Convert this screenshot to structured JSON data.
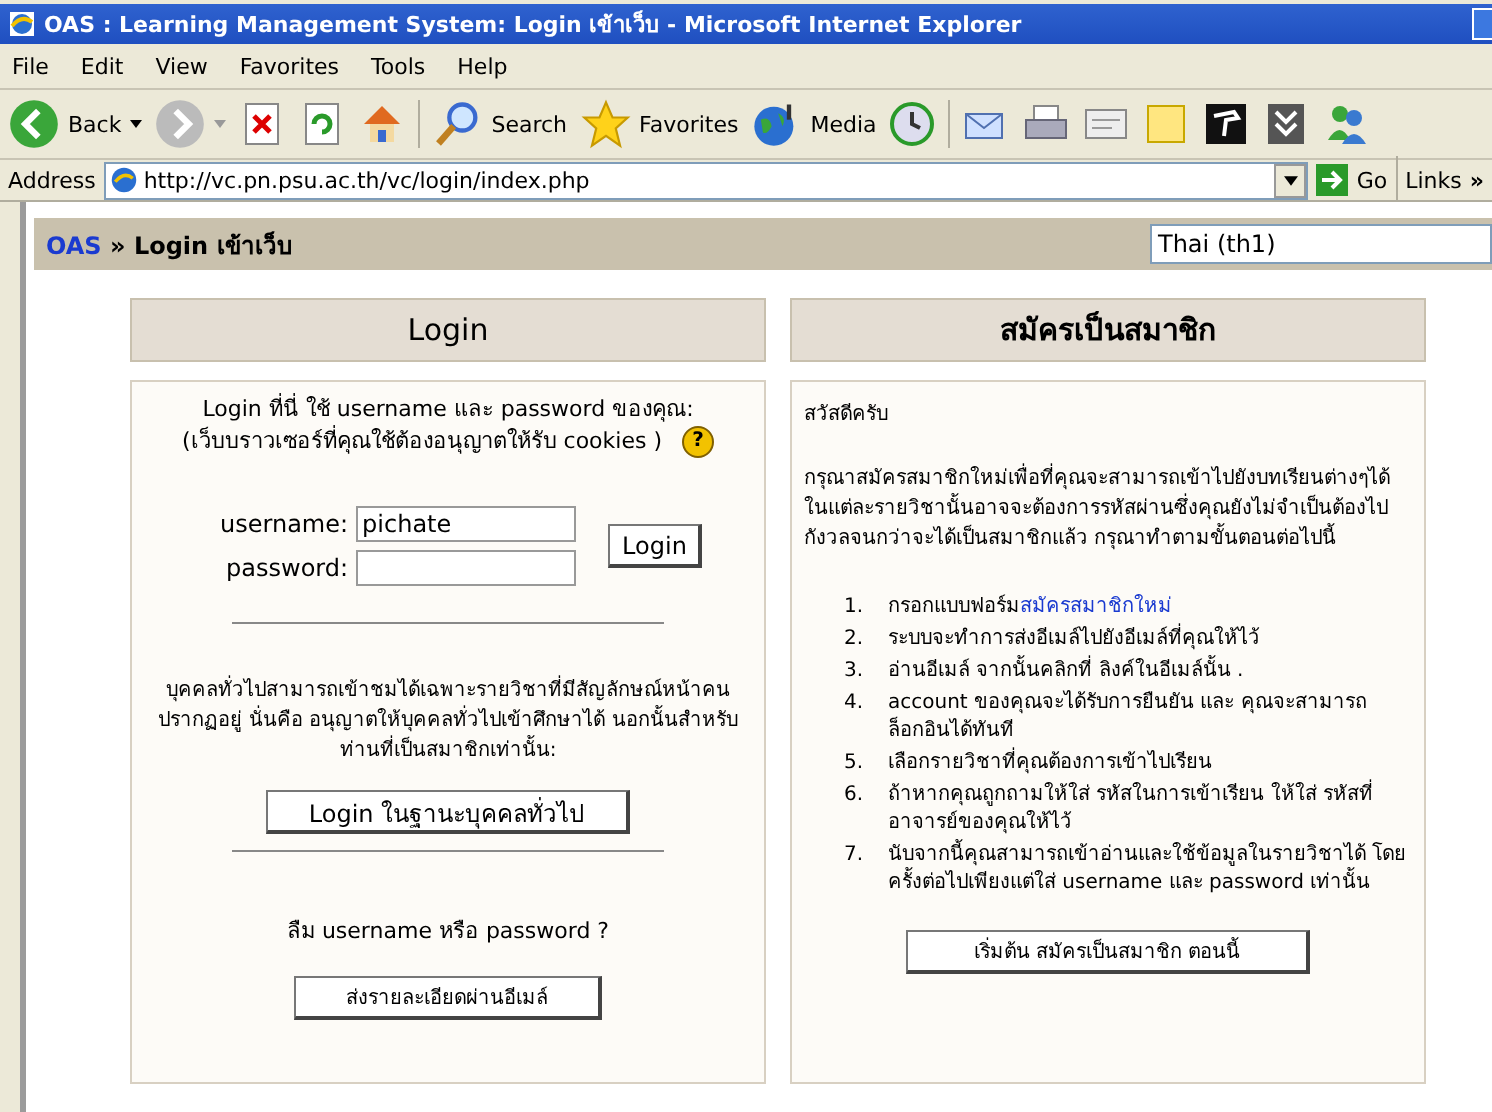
{
  "window": {
    "title": "OAS : Learning Management System: Login เข้าเว็บ - Microsoft Internet Explorer"
  },
  "menu": [
    "File",
    "Edit",
    "View",
    "Favorites",
    "Tools",
    "Help"
  ],
  "toolbar": {
    "back": "Back",
    "search": "Search",
    "favorites": "Favorites",
    "media": "Media"
  },
  "address": {
    "label": "Address",
    "value": "http://vc.pn.psu.ac.th/vc/login/index.php",
    "go": "Go",
    "links": "Links",
    "chevron": "»"
  },
  "breadcrumb": {
    "home": "OAS",
    "separator": "»",
    "current": "Login เข้าเว็บ",
    "language": "Thai (th1)"
  },
  "login": {
    "heading": "Login",
    "intro": [
      "Login ที่นี่ ใช้ username และ password ของคุณ:",
      "(เว็บบราวเซอร์ที่คุณใช้ต้องอนุญาตให้รับ cookies )"
    ],
    "help_icon": "?",
    "username_label": "username:",
    "username_value": "pichate",
    "password_label": "password:",
    "submit": "Login",
    "guest_text": "บุคคลทั่วไปสามารถเข้าชมได้เฉพาะรายวิชาที่มีสัญลักษณ์หน้าคน ปรากฏอยู่ นั่นคือ อนุญาตให้บุคคลทั่วไปเข้าศึกษาได้ นอกนั้นสำหรับท่านที่เป็นสมาชิกเท่านั้น:",
    "guest_button": "Login ในฐานะบุคคลทั่วไป",
    "forgot_text": "ลืม username หรือ password ?",
    "forgot_button": "ส่งรายละเอียดผ่านอีเมล์"
  },
  "signup": {
    "heading": "สมัครเป็นสมาชิก",
    "greeting": "สวัสดีครับ",
    "intro": "กรุณาสมัครสมาชิกใหม่เพื่อที่คุณจะสามารถเข้าไปยังบทเรียนต่างๆได้ ในแต่ละรายวิชานั้นอาจจะต้องการรหัสผ่านซึ่งคุณยังไม่จำเป็นต้องไปกังวลจนกว่าจะได้เป็นสมาชิกแล้ว กรุณาทำตามขั้นตอนต่อไปนี้",
    "steps": [
      {
        "number": "1.",
        "text": "กรอกแบบฟอร์ม",
        "link": "สมัครสมาชิกใหม่"
      },
      {
        "number": "2.",
        "text": "ระบบจะทำการส่งอีเมล์ไปยังอีเมล์ที่คุณให้ไว้"
      },
      {
        "number": "3.",
        "text": "อ่านอีเมล์ จากนั้นคลิกที่ ลิงค์ในอีเมล์นั้น ."
      },
      {
        "number": "4.",
        "text": "account ของคุณจะได้รับการยืนยัน และ คุณจะสามารถ ล็อกอินได้ทันที"
      },
      {
        "number": "5.",
        "text": "เลือกรายวิชาที่คุณต้องการเข้าไปเรียน"
      },
      {
        "number": "6.",
        "text": "ถ้าหากคุณถูกถามให้ใส่ รหัสในการเข้าเรียน ให้ใส่ รหัสที่อาจารย์ของคุณให้ไว้"
      },
      {
        "number": "7.",
        "text": "นับจากนี้คุณสามารถเข้าอ่านและใช้ข้อมูลในรายวิชาได้ โดยครั้งต่อไปเพียงแต่ใส่ username และ password เท่านั้น"
      }
    ],
    "button": "เริ่มต้น สมัครเป็นสมาชิก ตอนนี้"
  }
}
